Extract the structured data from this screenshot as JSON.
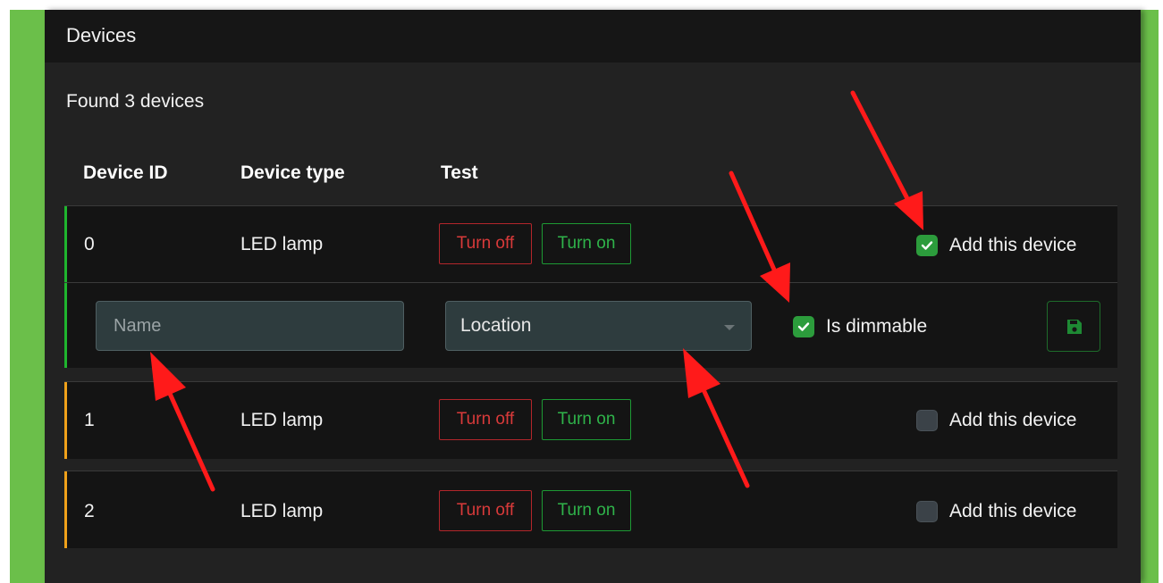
{
  "panel": {
    "title": "Devices",
    "found_text": "Found 3 devices"
  },
  "table": {
    "headers": [
      "Device ID",
      "Device type",
      "Test"
    ],
    "rows": [
      {
        "id": "0",
        "type": "LED lamp",
        "turn_off_label": "Turn off",
        "turn_on_label": "Turn on",
        "add_label": "Add this device",
        "add_checked": true,
        "accent_color": "#1fb52e",
        "details": {
          "name_placeholder": "Name",
          "name_value": "",
          "location_selected": "Location",
          "dimmable_label": "Is dimmable",
          "dimmable_checked": true,
          "save_icon": "floppy-disk-icon"
        }
      },
      {
        "id": "1",
        "type": "LED lamp",
        "turn_off_label": "Turn off",
        "turn_on_label": "Turn on",
        "add_label": "Add this device",
        "add_checked": false,
        "accent_color": "#f0a11a"
      },
      {
        "id": "2",
        "type": "LED lamp",
        "turn_off_label": "Turn off",
        "turn_on_label": "Turn on",
        "add_label": "Add this device",
        "add_checked": false,
        "accent_color": "#f0a11a"
      }
    ]
  },
  "colors": {
    "frame_green": "#6bbf4a",
    "panel_bg": "#222222",
    "row_bg": "#141414",
    "danger": "#d93a3a",
    "success": "#2fb34a",
    "annotation_arrow": "#ff1a1a"
  }
}
